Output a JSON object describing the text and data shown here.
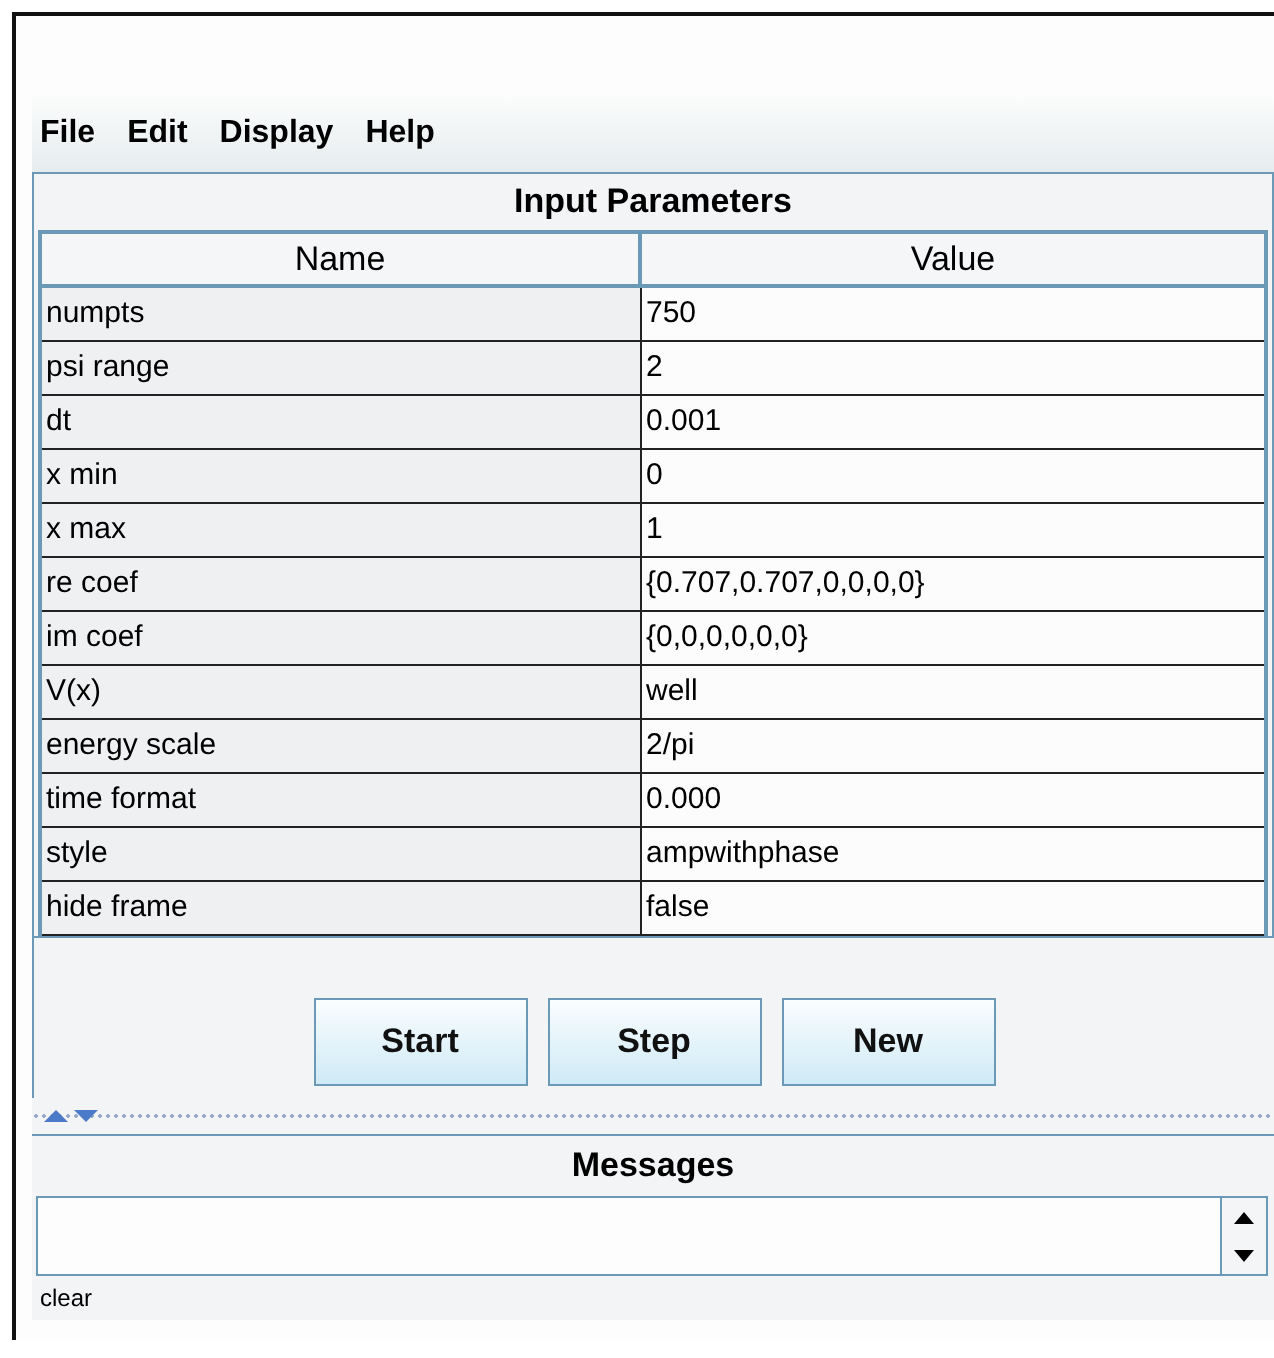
{
  "menu": [
    "File",
    "Edit",
    "Display",
    "Help"
  ],
  "parameters": {
    "title": "Input Parameters",
    "columns": [
      "Name",
      "Value"
    ],
    "rows": [
      {
        "name": "numpts",
        "value": "750"
      },
      {
        "name": "psi range",
        "value": "2"
      },
      {
        "name": "dt",
        "value": "0.001"
      },
      {
        "name": "x min",
        "value": "0"
      },
      {
        "name": "x max",
        "value": "1"
      },
      {
        "name": "re coef",
        "value": "{0.707,0.707,0,0,0,0}"
      },
      {
        "name": "im coef",
        "value": "{0,0,0,0,0,0}"
      },
      {
        "name": "V(x)",
        "value": "well"
      },
      {
        "name": "energy scale",
        "value": "2/pi"
      },
      {
        "name": "time format",
        "value": "0.000"
      },
      {
        "name": "style",
        "value": "ampwithphase"
      },
      {
        "name": "hide frame",
        "value": "false"
      }
    ]
  },
  "buttons": [
    "Start",
    "Step",
    "New"
  ],
  "messages": {
    "title": "Messages",
    "clear_label": "clear"
  }
}
